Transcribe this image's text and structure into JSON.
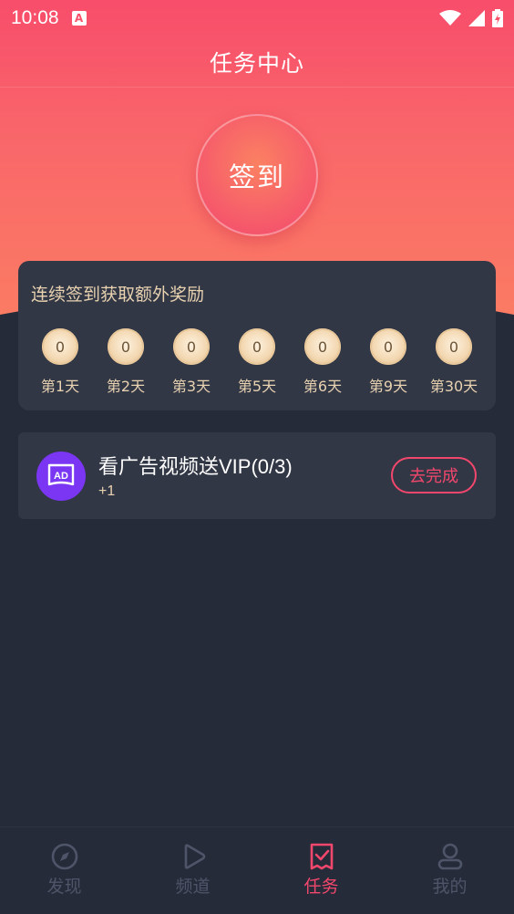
{
  "status_bar": {
    "time": "10:08",
    "notification_badge": "A"
  },
  "header": {
    "title": "任务中心"
  },
  "checkin": {
    "label": "签到"
  },
  "reward_card": {
    "title": "连续签到获取额外奖励",
    "days": [
      {
        "coin": "0",
        "label": "第1天"
      },
      {
        "coin": "0",
        "label": "第2天"
      },
      {
        "coin": "0",
        "label": "第3天"
      },
      {
        "coin": "0",
        "label": "第5天"
      },
      {
        "coin": "0",
        "label": "第6天"
      },
      {
        "coin": "0",
        "label": "第9天"
      },
      {
        "coin": "0",
        "label": "第30天"
      }
    ]
  },
  "task": {
    "icon_text": "AD",
    "title": "看广告视频送VIP(0/3)",
    "reward": "+1",
    "button": "去完成"
  },
  "tabbar": {
    "tabs": [
      {
        "label": "发现",
        "icon": "compass-icon"
      },
      {
        "label": "频道",
        "icon": "play-icon"
      },
      {
        "label": "任务",
        "icon": "task-check-icon"
      },
      {
        "label": "我的",
        "icon": "user-icon"
      }
    ],
    "active_color": "#f2476c",
    "inactive_color": "#4f5568"
  },
  "colors": {
    "accent": "#f2476c",
    "gold_text": "#e8d2b0",
    "background": "#262b3a",
    "card": "#323746"
  }
}
